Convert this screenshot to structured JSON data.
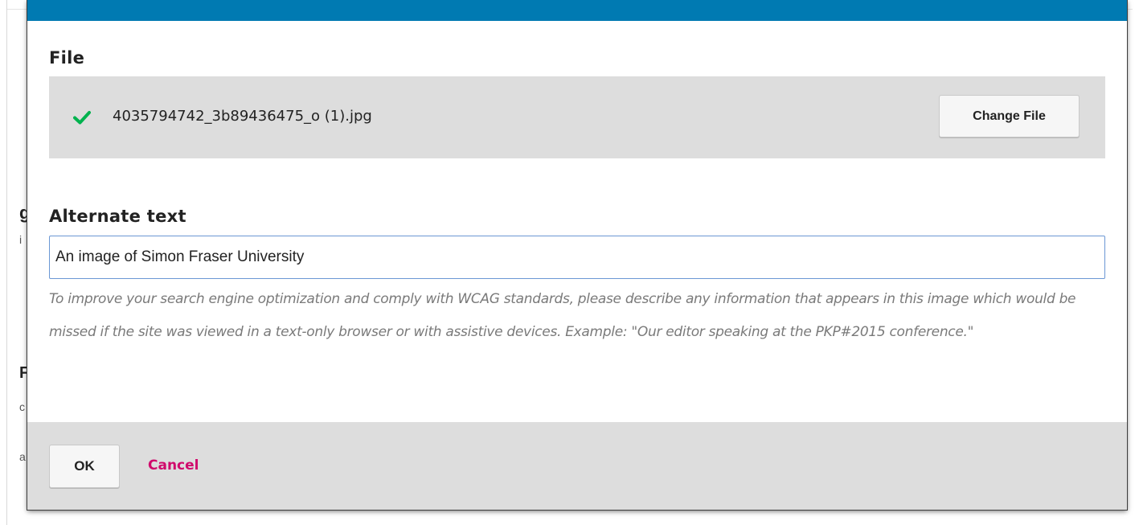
{
  "file_section": {
    "heading": "File",
    "file_name": "4035794742_3b89436475_o (1).jpg",
    "status_icon": "check-icon",
    "change_file_label": "Change File"
  },
  "alt_text_section": {
    "heading": "Alternate text",
    "value": "An image of Simon Fraser University",
    "help_text": "To improve your search engine optimization and comply with WCAG standards, please describe any information that appears in this image which would be missed if the site was viewed in a text-only browser or with assistive devices. Example: \"Our editor speaking at the PKP#2015 conference.\""
  },
  "footer": {
    "ok_label": "OK",
    "cancel_label": "Cancel"
  },
  "colors": {
    "topbar": "#007ab2",
    "check": "#00b24e",
    "cancel": "#d00a6c",
    "panel": "#dddddd",
    "input_focus_border": "#6b97d4",
    "help_text": "#7a7a7a"
  }
}
